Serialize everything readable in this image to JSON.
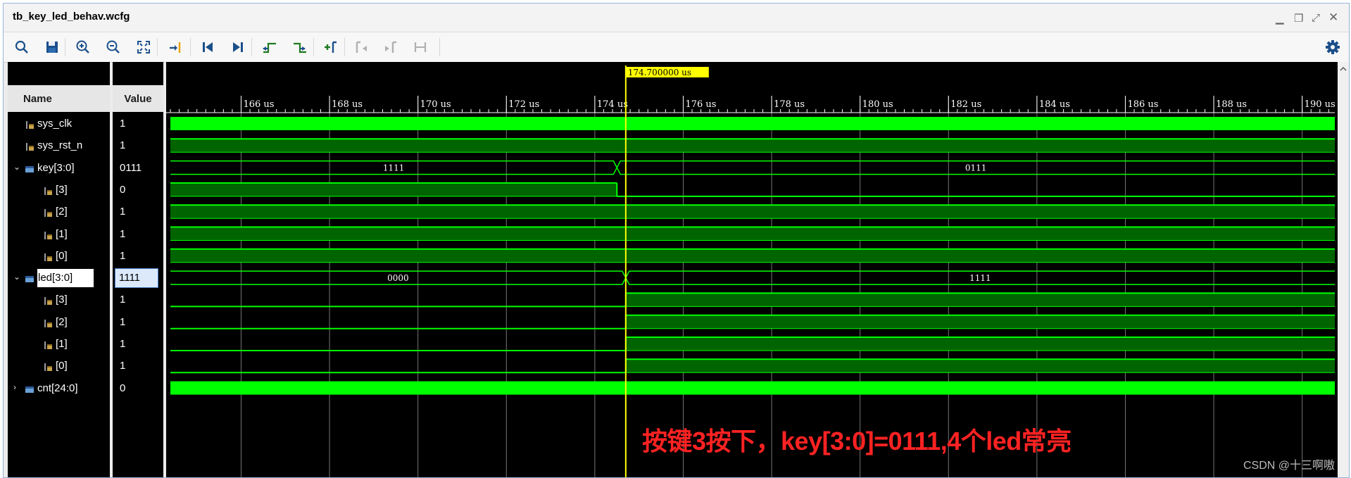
{
  "window": {
    "title": "tb_key_led_behav.wcfg",
    "controls": [
      "minimize-icon",
      "restore-icon",
      "float-icon",
      "close-icon"
    ]
  },
  "toolbar": {
    "buttons": [
      {
        "name": "search-icon"
      },
      {
        "name": "save-icon"
      },
      {
        "name": "zoom-in-icon"
      },
      {
        "name": "zoom-out-icon"
      },
      {
        "name": "zoom-fit-icon"
      },
      {
        "name": "go-to-cursor-icon"
      },
      {
        "name": "go-to-start-icon"
      },
      {
        "name": "go-to-end-icon"
      },
      {
        "name": "previous-transition-icon"
      },
      {
        "name": "next-transition-icon"
      },
      {
        "name": "add-marker-icon"
      },
      {
        "name": "previous-marker-icon"
      },
      {
        "name": "next-marker-icon"
      },
      {
        "name": "swap-cursors-icon"
      }
    ],
    "settings": "gear-icon"
  },
  "columns": {
    "name": "Name",
    "value": "Value"
  },
  "signals": [
    {
      "name": "sys_clk",
      "value": "1",
      "indent": 0,
      "expander": "",
      "icon": "bit-signal-icon"
    },
    {
      "name": "sys_rst_n",
      "value": "1",
      "indent": 0,
      "expander": "",
      "icon": "bit-signal-icon"
    },
    {
      "name": "key[3:0]",
      "value": "0111",
      "indent": 0,
      "expander": "⌄",
      "icon": "bus-signal-icon"
    },
    {
      "name": "[3]",
      "value": "0",
      "indent": 1,
      "expander": "",
      "icon": "bit-signal-icon"
    },
    {
      "name": "[2]",
      "value": "1",
      "indent": 1,
      "expander": "",
      "icon": "bit-signal-icon"
    },
    {
      "name": "[1]",
      "value": "1",
      "indent": 1,
      "expander": "",
      "icon": "bit-signal-icon"
    },
    {
      "name": "[0]",
      "value": "1",
      "indent": 1,
      "expander": "",
      "icon": "bit-signal-icon"
    },
    {
      "name": "led[3:0]",
      "value": "1111",
      "indent": 0,
      "expander": "⌄",
      "icon": "bus-signal-icon",
      "selected": true
    },
    {
      "name": "[3]",
      "value": "1",
      "indent": 1,
      "expander": "",
      "icon": "bit-signal-icon"
    },
    {
      "name": "[2]",
      "value": "1",
      "indent": 1,
      "expander": "",
      "icon": "bit-signal-icon"
    },
    {
      "name": "[1]",
      "value": "1",
      "indent": 1,
      "expander": "",
      "icon": "bit-signal-icon"
    },
    {
      "name": "[0]",
      "value": "1",
      "indent": 1,
      "expander": "",
      "icon": "bit-signal-icon"
    },
    {
      "name": "cnt[24:0]",
      "value": "0",
      "indent": 0,
      "expander": "›",
      "icon": "bus-signal-icon"
    }
  ],
  "timeline": {
    "cursor_label": "174.700000 us",
    "cursor_time_us": 174.7,
    "start_us": 164.4,
    "end_us": 190.6,
    "ticks": [
      "166 us",
      "168 us",
      "170 us",
      "172 us",
      "174 us",
      "176 us",
      "178 us",
      "180 us",
      "182 us",
      "184 us",
      "186 us",
      "188 us",
      "190 us"
    ],
    "tick_values_us": [
      166,
      168,
      170,
      172,
      174,
      176,
      178,
      180,
      182,
      184,
      186,
      188,
      190
    ]
  },
  "waveforms": {
    "key_bus": {
      "before": "1111",
      "after": "0111",
      "transition_us": 174.5
    },
    "key3_falls_at_us": 174.5,
    "led_bus": {
      "before": "0000",
      "after": "1111",
      "transition_us": 174.7
    },
    "led_bits_rise_at_us": 174.7
  },
  "colors": {
    "wave": "#00ff00",
    "bus_fill": "#006400",
    "cursor": "#ffff00",
    "gridline": "#8a8a8a",
    "annotation": "#ff2222"
  },
  "annotation": "按键3按下，key[3:0]=0111,4个led常亮",
  "watermark": "CSDN @十三啊嗷"
}
